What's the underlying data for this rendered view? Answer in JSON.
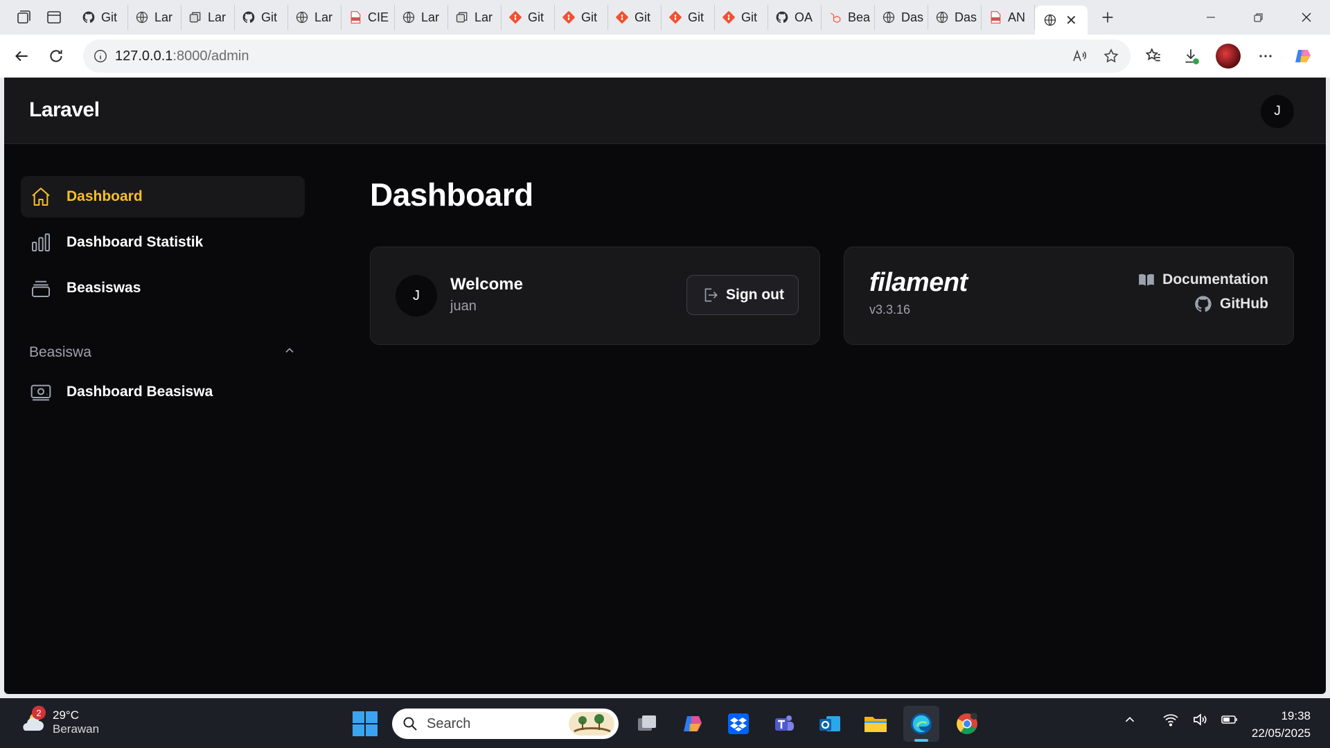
{
  "browser": {
    "tabs": [
      {
        "label": "Git",
        "icon": "github-icon"
      },
      {
        "label": "Lar",
        "icon": "globe-icon"
      },
      {
        "label": "Lar",
        "icon": "tab-group-icon"
      },
      {
        "label": "Git",
        "icon": "github-icon"
      },
      {
        "label": "Lar",
        "icon": "globe-icon"
      },
      {
        "label": "CIE",
        "icon": "pdf-icon"
      },
      {
        "label": "Lar",
        "icon": "globe-icon"
      },
      {
        "label": "Lar",
        "icon": "tab-group-icon"
      },
      {
        "label": "Git",
        "icon": "git-icon"
      },
      {
        "label": "Git",
        "icon": "git-icon"
      },
      {
        "label": "Git",
        "icon": "git-icon"
      },
      {
        "label": "Git",
        "icon": "git-icon"
      },
      {
        "label": "Git",
        "icon": "git-icon"
      },
      {
        "label": "OA",
        "icon": "github-icon"
      },
      {
        "label": "Bea",
        "icon": "laravel-icon"
      },
      {
        "label": "Das",
        "icon": "globe-icon"
      },
      {
        "label": "Das",
        "icon": "globe-icon"
      },
      {
        "label": "AN",
        "icon": "pdf-icon"
      }
    ],
    "url_host": "127.0.0.1",
    "url_path": ":8000/admin"
  },
  "app": {
    "brand": "Laravel",
    "user_initial": "J",
    "page_title": "Dashboard",
    "sidebar": {
      "items": [
        {
          "label": "Dashboard",
          "icon": "home-icon",
          "active": true
        },
        {
          "label": "Dashboard Statistik",
          "icon": "bar-chart-icon",
          "active": false
        },
        {
          "label": "Beasiswas",
          "icon": "stack-icon",
          "active": false
        }
      ],
      "group_label": "Beasiswa",
      "group_items": [
        {
          "label": "Dashboard Beasiswa",
          "icon": "banknote-icon"
        }
      ]
    },
    "welcome_card": {
      "avatar_initial": "J",
      "title": "Welcome",
      "username": "juan",
      "signout_label": "Sign out"
    },
    "filament_card": {
      "logo": "filament",
      "version": "v3.3.16",
      "documentation_label": "Documentation",
      "github_label": "GitHub"
    },
    "colors": {
      "accent": "#fbbf24",
      "background": "#09090b",
      "panel": "#18181b"
    }
  },
  "taskbar": {
    "weather_temp": "29°C",
    "weather_desc": "Berawan",
    "notification_count": "2",
    "search_placeholder": "Search",
    "time": "19:38",
    "date": "22/05/2025"
  }
}
